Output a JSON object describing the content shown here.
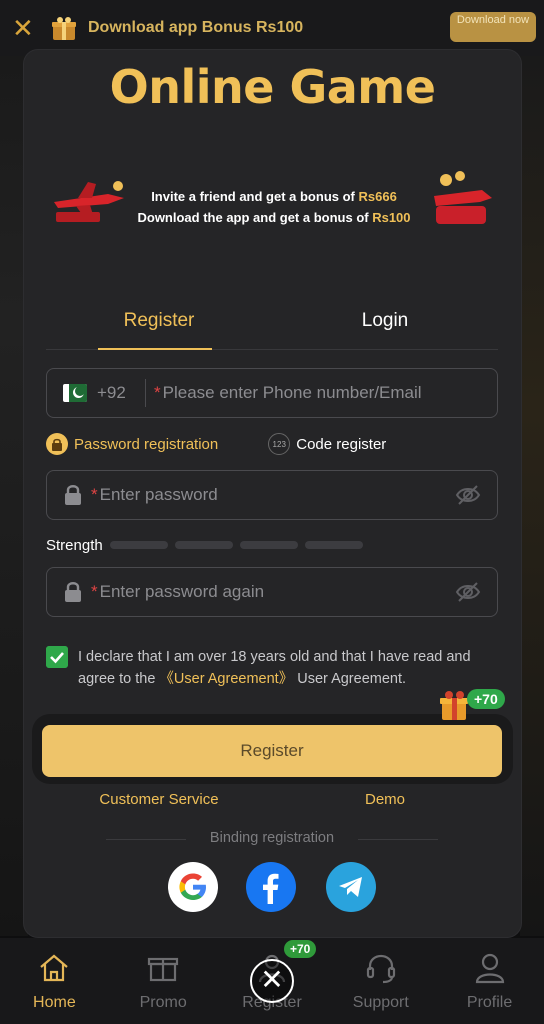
{
  "topbar": {
    "close_label": "✕",
    "text": "Download app Bonus Rs100",
    "download_button": "Download now"
  },
  "modal": {
    "brand": "Online Game",
    "promo": {
      "line1_prefix": "Invite a friend and get a bonus of ",
      "line1_amount": "Rs666",
      "line2_prefix": "Download the app and get a bonus of ",
      "line2_amount": "Rs100"
    },
    "tabs": [
      {
        "label": "Register",
        "active": true
      },
      {
        "label": "Login",
        "active": false
      }
    ],
    "phone": {
      "code": "+92",
      "placeholder": "Please enter Phone number/Email"
    },
    "methods": {
      "password_registration": "Password registration",
      "code_register": "Code register",
      "code_icon_text": "123"
    },
    "password": {
      "placeholder": "Enter password"
    },
    "strength_label": "Strength",
    "password_again": {
      "placeholder": "Enter password again"
    },
    "agreement": {
      "text1": "I declare that I am over 18 years old and that I have read and agree to the ",
      "link": "《User Agreement》",
      "text2": " User Agreement."
    },
    "register_button": "Register",
    "bonus_badge": "+70",
    "links": {
      "customer_service": "Customer Service",
      "demo": "Demo"
    },
    "binding_label": "Binding registration"
  },
  "bottom_nav": {
    "items": [
      {
        "label": "Home",
        "icon": "home-icon",
        "active": true
      },
      {
        "label": "Promo",
        "icon": "gift-icon",
        "active": false
      },
      {
        "label": "Register",
        "icon": "register-icon",
        "active": false
      },
      {
        "label": "Support",
        "icon": "headset-icon",
        "active": false
      },
      {
        "label": "Profile",
        "icon": "user-icon",
        "active": false
      }
    ],
    "register_badge": "+70"
  },
  "colors": {
    "accent": "#f0c058",
    "button": "#eec46a",
    "success": "#2fa84a",
    "modal_bg": "#252527"
  }
}
